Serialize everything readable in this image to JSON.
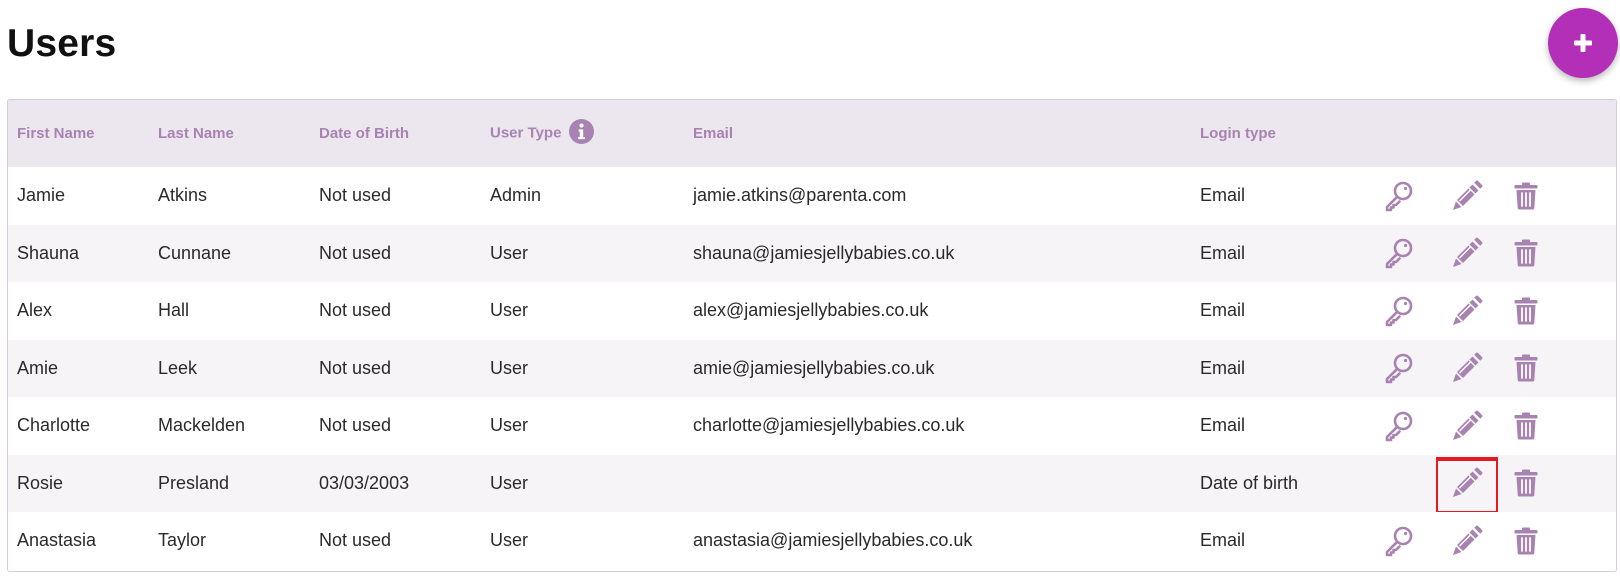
{
  "page": {
    "title": "Users"
  },
  "add_button": {
    "icon": "plus-icon",
    "color": "#b32fb8"
  },
  "table": {
    "columns": {
      "first_name": "First Name",
      "last_name": "Last Name",
      "dob": "Date of Birth",
      "user_type": "User Type",
      "email": "Email",
      "login_type": "Login type"
    },
    "user_type_info_icon": "info-circle-icon",
    "rows": [
      {
        "first_name": "Jamie",
        "last_name": "Atkins",
        "dob": "Not used",
        "user_type": "Admin",
        "email": "jamie.atkins@parenta.com",
        "login_type": "Email",
        "has_key": true
      },
      {
        "first_name": "Shauna",
        "last_name": "Cunnane",
        "dob": "Not used",
        "user_type": "User",
        "email": "shauna@jamiesjellybabies.co.uk",
        "login_type": "Email",
        "has_key": true
      },
      {
        "first_name": "Alex",
        "last_name": "Hall",
        "dob": "Not used",
        "user_type": "User",
        "email": "alex@jamiesjellybabies.co.uk",
        "login_type": "Email",
        "has_key": true
      },
      {
        "first_name": "Amie",
        "last_name": "Leek",
        "dob": "Not used",
        "user_type": "User",
        "email": "amie@jamiesjellybabies.co.uk",
        "login_type": "Email",
        "has_key": true
      },
      {
        "first_name": "Charlotte",
        "last_name": "Mackelden",
        "dob": "Not used",
        "user_type": "User",
        "email": "charlotte@jamiesjellybabies.co.uk",
        "login_type": "Email",
        "has_key": true
      },
      {
        "first_name": "Rosie",
        "last_name": "Presland",
        "dob": "03/03/2003",
        "user_type": "User",
        "email": "",
        "login_type": "Date of birth",
        "has_key": false,
        "edit_highlighted": true
      },
      {
        "first_name": "Anastasia",
        "last_name": "Taylor",
        "dob": "Not used",
        "user_type": "User",
        "email": "anastasia@jamiesjellybabies.co.uk",
        "login_type": "Email",
        "has_key": true
      }
    ],
    "row_actions": [
      "key-icon",
      "pencil-icon",
      "trash-icon"
    ]
  },
  "colors": {
    "accent": "#b32fb8",
    "header_bg": "#ece6ef",
    "header_text": "#a883b2",
    "icon": "#a883b2",
    "highlight": "#e01b24"
  }
}
